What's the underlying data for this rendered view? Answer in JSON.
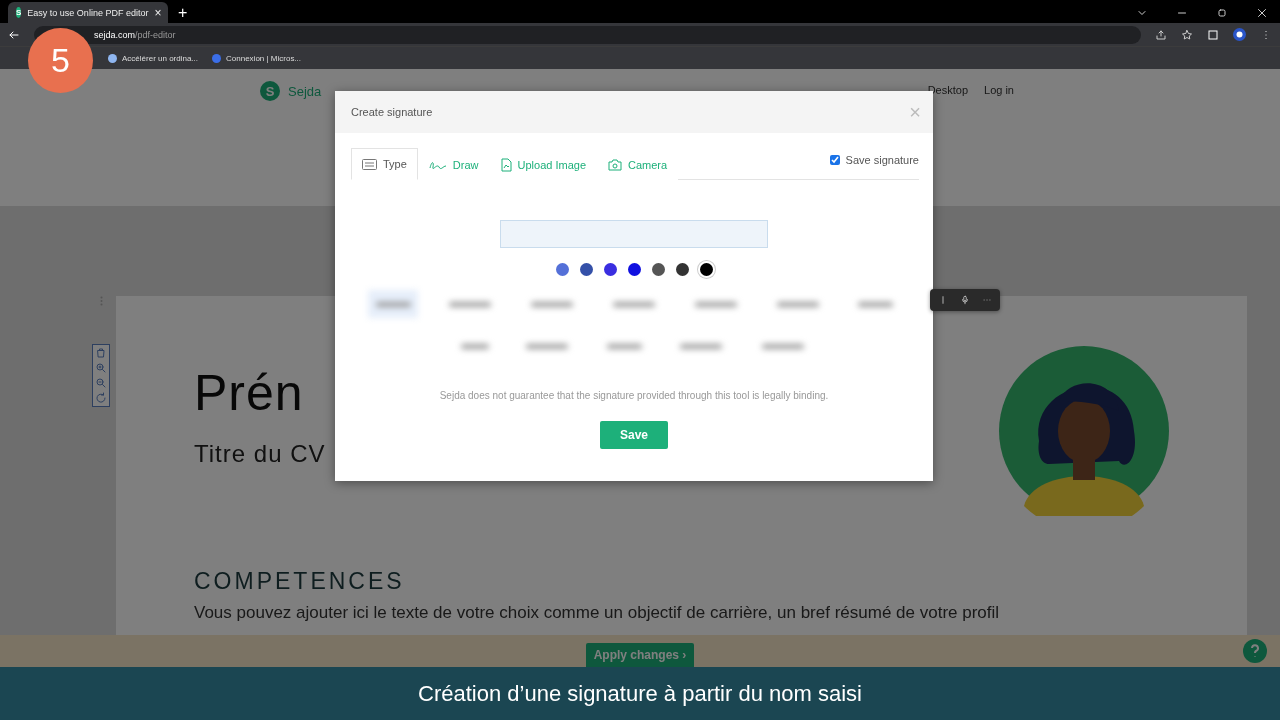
{
  "browser": {
    "tab_title": "Easy to use Online PDF editor",
    "tab_close": "×",
    "new_tab": "+",
    "url_host": "sejda.com",
    "url_path": "/pdf-editor",
    "bookmarks": [
      {
        "label": "Accélérer un ordina..."
      },
      {
        "label": "Connexion | Micros..."
      }
    ]
  },
  "favicon_letter": "S",
  "step_badge": "5",
  "site": {
    "logo_mark": "S",
    "logo": "Sejda",
    "nav": [
      "Desktop",
      "Log in"
    ]
  },
  "document": {
    "name": "Prén",
    "subtitle": "Titre du CV",
    "section": "COMPETENCES",
    "paragraph": "Vous pouvez ajouter ici le texte de votre choix comme un objectif de carrière, un bref résumé de votre profil"
  },
  "modal": {
    "title": "Create signature",
    "close": "×",
    "tabs": [
      {
        "label": "Type",
        "kind": "keyboard",
        "selected": true
      },
      {
        "label": "Draw",
        "kind": "pen",
        "selected": false
      },
      {
        "label": "Upload Image",
        "kind": "file",
        "selected": false
      },
      {
        "label": "Camera",
        "kind": "camera",
        "selected": false
      }
    ],
    "save_signature": {
      "label": "Save signature",
      "checked": true
    },
    "colors": [
      {
        "color": "#5470d8",
        "selected": false
      },
      {
        "color": "#3450a8",
        "selected": false
      },
      {
        "color": "#3a2ee0",
        "selected": false
      },
      {
        "color": "#1010e0",
        "selected": false
      },
      {
        "color": "#555555",
        "selected": false
      },
      {
        "color": "#333333",
        "selected": false
      },
      {
        "color": "#000000",
        "selected": true
      }
    ],
    "disclaimer": "Sejda does not guarantee that the signature provided through this tool is legally binding.",
    "save_button": "Save"
  },
  "apply_button": "Apply changes ›",
  "caption": "Création d’une signature à partir du nom saisi"
}
